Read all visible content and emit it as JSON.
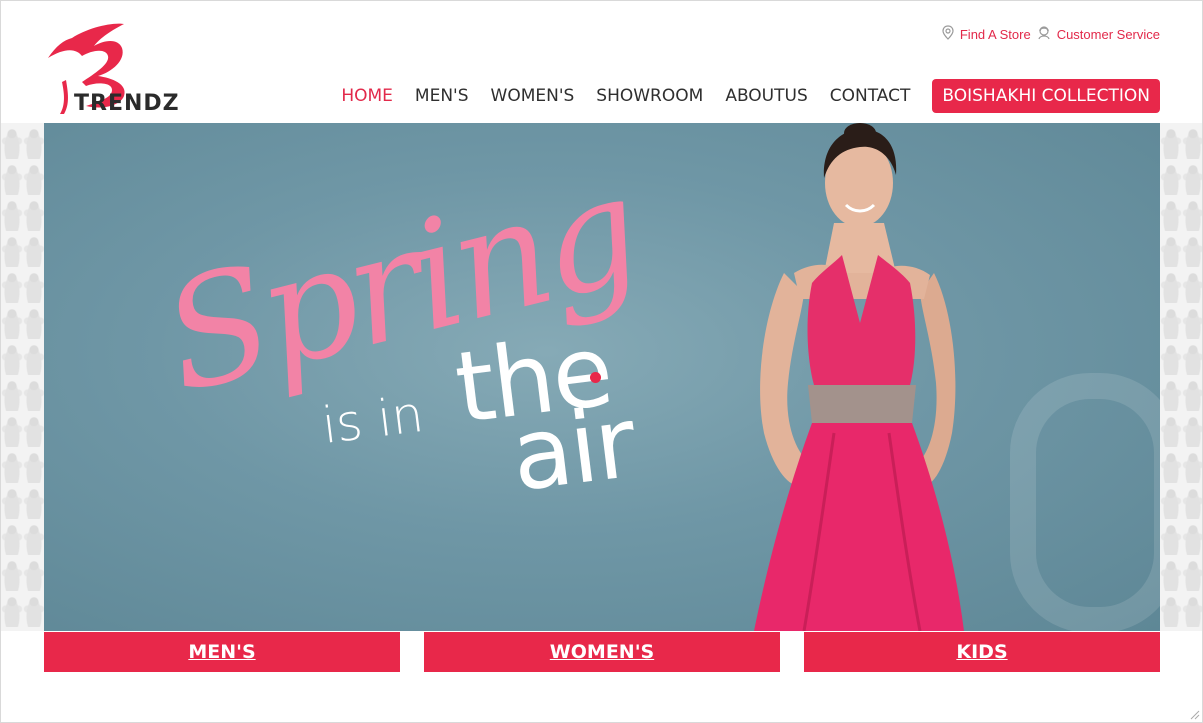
{
  "brand": {
    "name": "TRENDZ",
    "accent_color": "#e8284a",
    "logo_icon": "trendz-logo-icon"
  },
  "utility": {
    "store": {
      "label": "Find A Store",
      "icon": "location-pin-icon"
    },
    "service": {
      "label": "Customer Service",
      "icon": "customer-service-icon"
    }
  },
  "nav": {
    "items": [
      {
        "label": "HOME",
        "active": true
      },
      {
        "label": "MEN'S"
      },
      {
        "label": "WOMEN'S"
      },
      {
        "label": "SHOWROOM"
      },
      {
        "label": "ABOUTUS"
      },
      {
        "label": "CONTACT"
      }
    ],
    "cta": "BOISHAKHI COLLECTION"
  },
  "hero": {
    "script_text": "Spring",
    "line1": "is in",
    "line2": "the",
    "line3": "air",
    "background_color": "#6f97a6",
    "script_color": "#f283a6"
  },
  "categories": [
    "MEN'S",
    "WOMEN'S",
    "KIDS"
  ]
}
